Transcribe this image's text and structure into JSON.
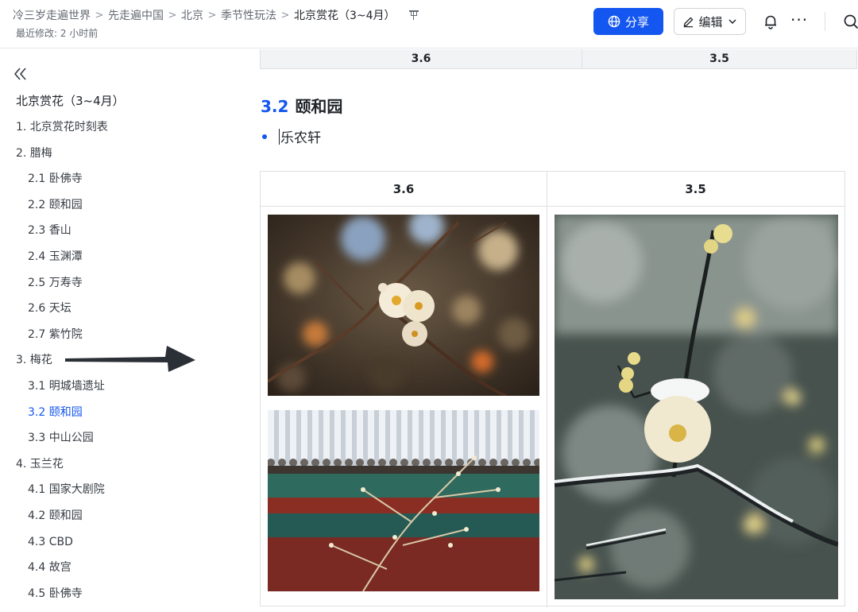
{
  "header": {
    "breadcrumbs": [
      "冷三岁走遍世界",
      "先走遍中国",
      "北京",
      "季节性玩法",
      "北京赏花（3~4月）"
    ],
    "separator": ">",
    "last_modified": "最近修改: 2 小时前",
    "share_label": "分享",
    "edit_label": "编辑",
    "more_label": "···",
    "accent_color": "#1456f0"
  },
  "sidebar": {
    "title": "北京赏花（3~4月）",
    "items": [
      {
        "label": "1. 北京赏花时刻表",
        "level": 1
      },
      {
        "label": "2. 腊梅",
        "level": 1
      },
      {
        "label": "2.1 卧佛寺",
        "level": 2
      },
      {
        "label": "2.2 颐和园",
        "level": 2
      },
      {
        "label": "2.3 香山",
        "level": 2
      },
      {
        "label": "2.4 玉渊潭",
        "level": 2
      },
      {
        "label": "2.5 万寿寺",
        "level": 2
      },
      {
        "label": "2.6 天坛",
        "level": 2
      },
      {
        "label": "2.7 紫竹院",
        "level": 2
      },
      {
        "label": "3. 梅花",
        "level": 1
      },
      {
        "label": "3.1 明城墙遗址",
        "level": 2
      },
      {
        "label": "3.2 颐和园",
        "level": 2,
        "active": true
      },
      {
        "label": "3.3 中山公园",
        "level": 2
      },
      {
        "label": "4. 玉兰花",
        "level": 1
      },
      {
        "label": "4.1 国家大剧院",
        "level": 2
      },
      {
        "label": "4.2 颐和园",
        "level": 2
      },
      {
        "label": "4.3 CBD",
        "level": 2
      },
      {
        "label": "4.4 故宫",
        "level": 2
      },
      {
        "label": "4.5 卧佛寺",
        "level": 2
      }
    ]
  },
  "main": {
    "top_table": [
      "3.6",
      "3.5"
    ],
    "heading_number": "3.2",
    "heading_text": "颐和园",
    "bullet": "乐农轩",
    "gallery_headers": [
      "3.6",
      "3.5"
    ],
    "images": [
      {
        "icon": "plum-blossom-photo",
        "column": "3.6"
      },
      {
        "icon": "palace-roof-snow-photo",
        "column": "3.6"
      },
      {
        "icon": "snow-plum-blossom-photo",
        "column": "3.5"
      }
    ]
  }
}
